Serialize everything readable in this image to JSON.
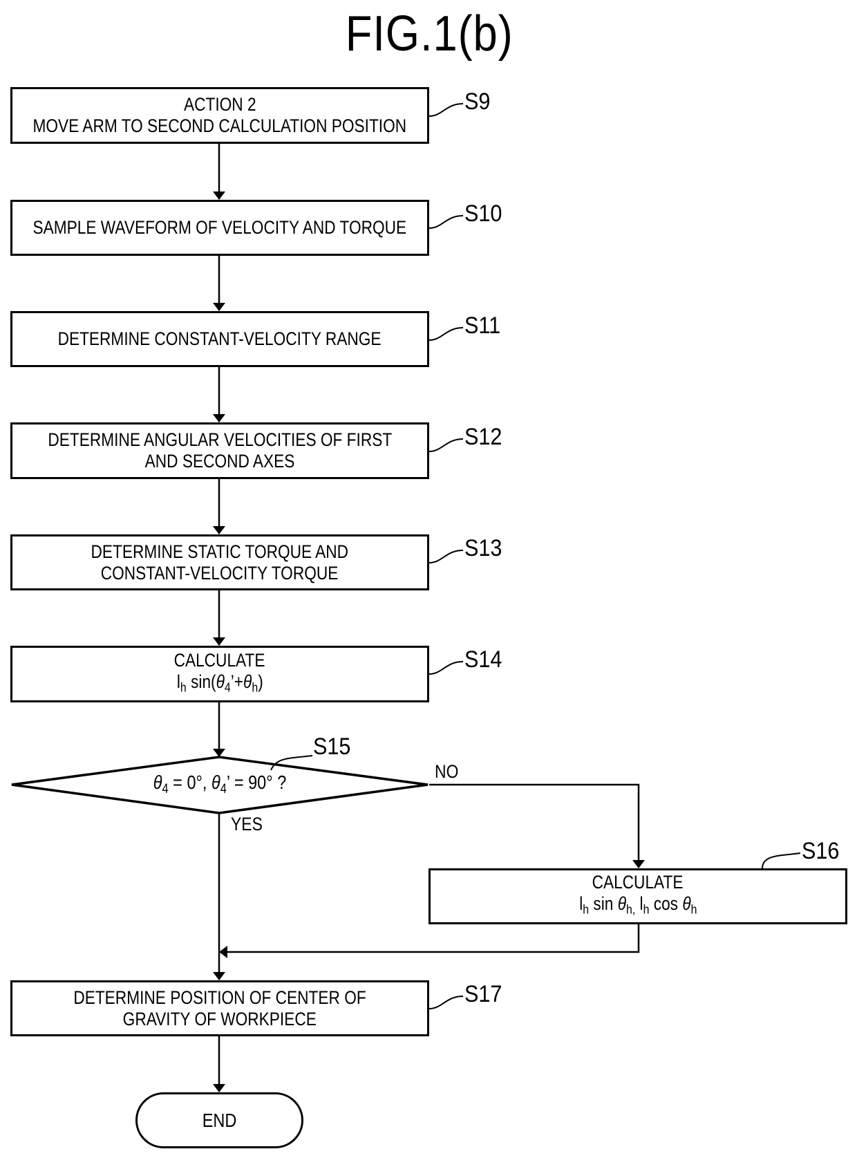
{
  "figure": {
    "title": "FIG.1(b)"
  },
  "steps": {
    "s9": {
      "label": "S9",
      "lines": [
        "ACTION 2",
        "MOVE ARM TO SECOND CALCULATION POSITION"
      ]
    },
    "s10": {
      "label": "S10",
      "lines": [
        "SAMPLE WAVEFORM OF VELOCITY AND TORQUE"
      ]
    },
    "s11": {
      "label": "S11",
      "lines": [
        "DETERMINE CONSTANT-VELOCITY RANGE"
      ]
    },
    "s12": {
      "label": "S12",
      "lines": [
        "DETERMINE ANGULAR VELOCITIES OF FIRST",
        "AND SECOND AXES"
      ]
    },
    "s13": {
      "label": "S13",
      "lines": [
        "DETERMINE STATIC TORQUE AND",
        "CONSTANT-VELOCITY TORQUE"
      ]
    },
    "s14": {
      "label": "S14",
      "line1": "CALCULATE",
      "formula": {
        "l": "l",
        "l_sub": "h",
        "sin": " sin(",
        "theta4": "θ",
        "theta4_sub": "4",
        "prime_plus": "’+",
        "thetah": "θ",
        "thetah_sub": "h",
        "close": ")"
      }
    },
    "s15": {
      "label": "S15",
      "theta_a": "θ",
      "sub_a": "4",
      "cond_a": " = 0°,  ",
      "theta_b": "θ",
      "sub_b": "4",
      "cond_b": "’ = 90°  ?",
      "yes": "YES",
      "no": "NO"
    },
    "s16": {
      "label": "S16",
      "line1": "CALCULATE",
      "f1": "l",
      "f1_sub": "h",
      "f2": " sin ",
      "f3": "θ",
      "f3_sub": "h,",
      "f4": " l",
      "f4_sub": "h",
      "f5": " cos ",
      "f6": "θ",
      "f6_sub": "h"
    },
    "s17": {
      "label": "S17",
      "lines": [
        "DETERMINE POSITION OF CENTER OF",
        "GRAVITY OF WORKPIECE"
      ]
    },
    "end": {
      "label": "END"
    }
  }
}
